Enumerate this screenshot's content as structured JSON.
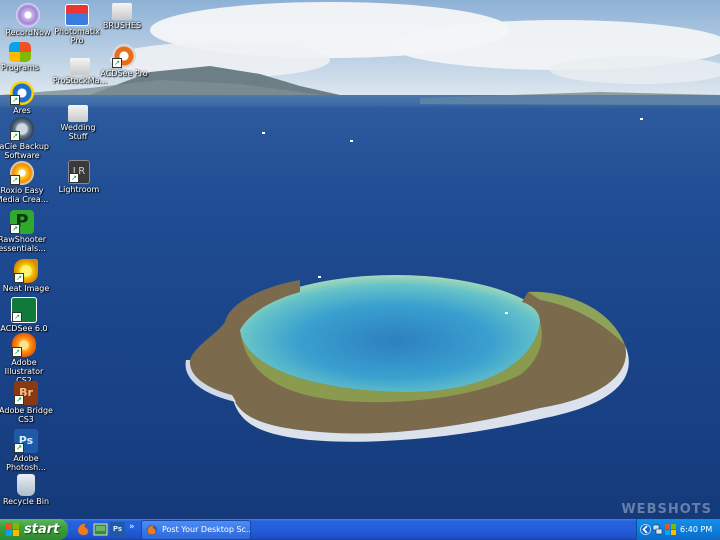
{
  "desktop": {
    "icons": [
      {
        "label": "RecordNow",
        "icon": "recordnow-icon",
        "shortcut": false
      },
      {
        "label": "Photomatix Pro",
        "icon": "photomatix-icon",
        "shortcut": false
      },
      {
        "label": "BRUSHES",
        "icon": "folder-icon",
        "shortcut": false
      },
      {
        "label": "Programs",
        "icon": "programs-icon",
        "shortcut": false
      },
      {
        "label": "ProStockMa...",
        "icon": "folder-icon",
        "shortcut": false
      },
      {
        "label": "ACDSee Pro",
        "icon": "acdsee-pro-icon",
        "shortcut": true
      },
      {
        "label": "Ares",
        "icon": "ares-icon",
        "shortcut": true
      },
      {
        "label": "Wedding Stuff",
        "icon": "folder-icon",
        "shortcut": false
      },
      {
        "label": "LaCie Backup Software",
        "icon": "lacie-icon",
        "shortcut": true
      },
      {
        "label": "Lightroom",
        "icon": "lightroom-icon",
        "shortcut": true
      },
      {
        "label": "Roxio Easy Media Crea...",
        "icon": "roxio-icon",
        "shortcut": true
      },
      {
        "label": "RawShooter essentials...",
        "icon": "rawshooter-icon",
        "shortcut": true
      },
      {
        "label": "Neat Image",
        "icon": "neat-image-icon",
        "shortcut": true
      },
      {
        "label": "ACDSee 6.0",
        "icon": "acdsee-icon",
        "shortcut": true
      },
      {
        "label": "Adobe Illustrator CS2",
        "icon": "illustrator-icon",
        "shortcut": true
      },
      {
        "label": "Adobe Bridge CS3",
        "icon": "bridge-icon",
        "shortcut": true
      },
      {
        "label": "Adobe Photosh...",
        "icon": "photoshop-icon",
        "shortcut": true
      },
      {
        "label": "Recycle Bin",
        "icon": "recycle-bin-icon",
        "shortcut": false
      }
    ],
    "lightroom_glyph": "LR",
    "bridge_glyph": "Br",
    "photoshop_glyph": "Ps",
    "watermark": "WEBSHOTS"
  },
  "taskbar": {
    "start_label": "start",
    "quick_launch_chevron": "»",
    "task_button_label": "Post Your Desktop Sc...",
    "tray_clock": "6:40 PM"
  },
  "colors": {
    "taskbar_blue": "#245edb",
    "start_green": "#3c9f3c",
    "tray_blue": "#0f7fdc"
  }
}
